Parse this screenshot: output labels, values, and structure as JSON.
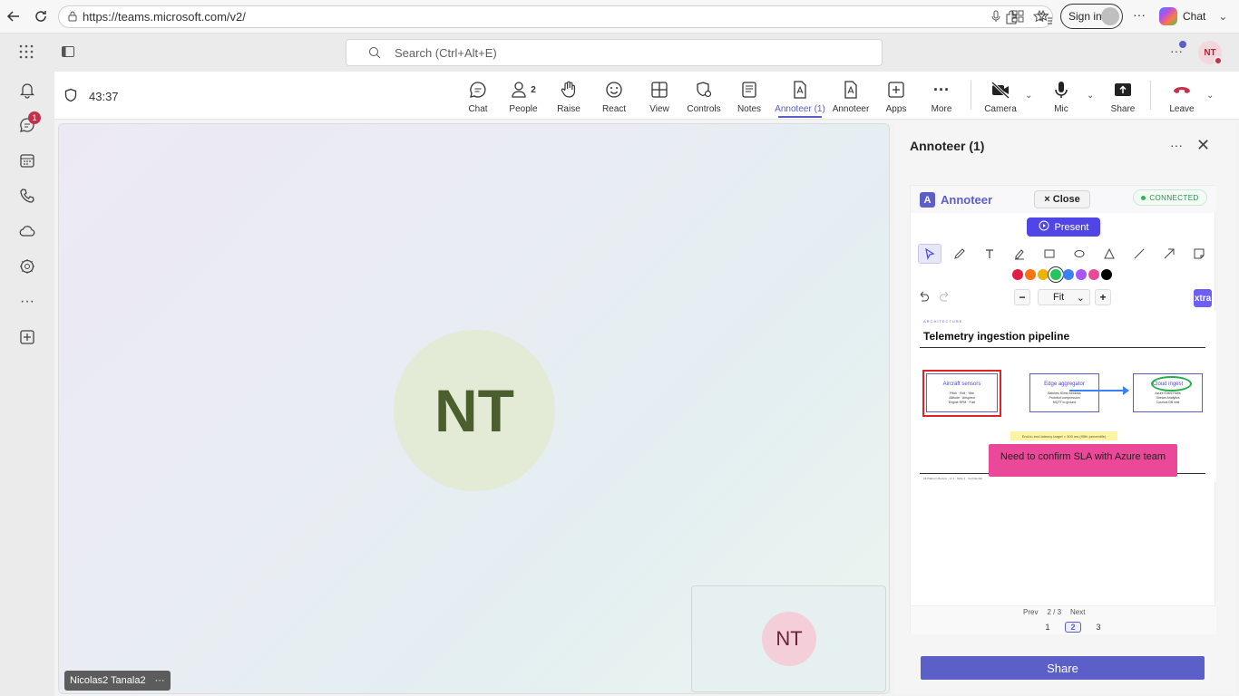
{
  "browser": {
    "url": "https://teams.microsoft.com/v2/",
    "signin_label": "Sign in",
    "chat_label": "Chat"
  },
  "header": {
    "search_placeholder": "Search (Ctrl+Alt+E)",
    "user_initials": "NT"
  },
  "rail": {
    "chat_badge": "1"
  },
  "meeting": {
    "timer": "43:37",
    "toolbar": [
      {
        "label": "Chat"
      },
      {
        "label": "People",
        "count": "2"
      },
      {
        "label": "Raise"
      },
      {
        "label": "React"
      },
      {
        "label": "View"
      },
      {
        "label": "Controls"
      },
      {
        "label": "Notes"
      },
      {
        "label": "Annoteer (1)"
      },
      {
        "label": "Annoteer"
      },
      {
        "label": "Apps"
      },
      {
        "label": "More"
      },
      {
        "label": "Camera"
      },
      {
        "label": "Mic"
      },
      {
        "label": "Share"
      },
      {
        "label": "Leave"
      }
    ]
  },
  "stage": {
    "main_initials": "NT",
    "self_initials": "NT",
    "participant_name": "Nicolas2 Tanala2"
  },
  "panel": {
    "title": "Annoteer (1)",
    "app_name": "Annoteer",
    "close_label": "× Close",
    "status": "CONNECTED",
    "present_label": "Present",
    "colors": [
      "#e11d48",
      "#f97316",
      "#eab308",
      "#22c55e",
      "#3b82f6",
      "#a855f7",
      "#ec4899",
      "#000000"
    ],
    "selected_color": "#22c55e",
    "zoom": "Fit",
    "extra_label": "xtra",
    "doc": {
      "eyebrow": "ARCHITECTURE",
      "title": "Telemetry ingestion pipeline",
      "boxes": [
        {
          "title": "Aircraft sensors",
          "lines": [
            "Pitch · Roll · Yaw",
            "Altitude · Airspeed",
            "Engine RPM · Fuel"
          ]
        },
        {
          "title": "Edge aggregator",
          "lines": [
            "Batches 50ms windows",
            "Protobuf compression",
            "MQTT to ground"
          ]
        },
        {
          "title": "Cloud ingest",
          "lines": [
            "Azure Event Hubs",
            "Stream Analytics",
            "Cosmos DB sink"
          ]
        }
      ],
      "highlight": "End-to-end latency target < 300 ms (95th percentile)",
      "sticky": "Need to confirm SLA with Azure team",
      "footer": "All Platform Review · v1.1 · Slide 2 · Confidential"
    },
    "pager": {
      "prev": "Prev",
      "position": "2 / 3",
      "next": "Next",
      "pages": [
        "1",
        "2",
        "3"
      ],
      "current": "2"
    },
    "share_label": "Share"
  }
}
